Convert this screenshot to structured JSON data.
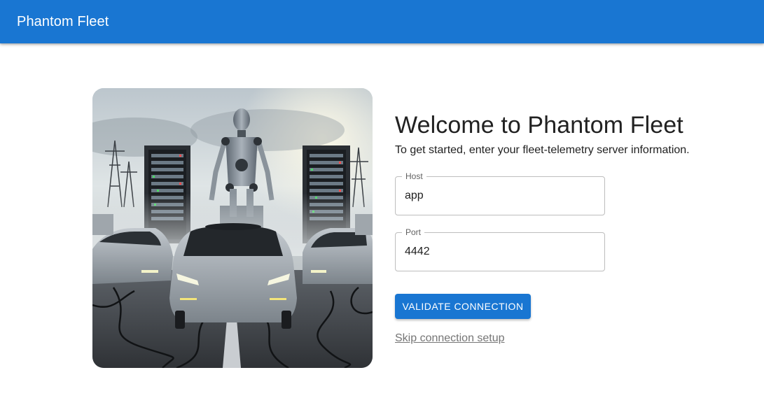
{
  "appbar": {
    "title": "Phantom Fleet",
    "color": "#1976d2"
  },
  "hero": {
    "image_description_icon": "robot-fleet-illustration"
  },
  "welcome": {
    "title": "Welcome to Phantom Fleet",
    "subtitle": "To get started, enter your fleet-telemetry server information."
  },
  "form": {
    "host": {
      "label": "Host",
      "value": "app"
    },
    "port": {
      "label": "Port",
      "value": "4442"
    },
    "validate_label": "VALIDATE CONNECTION",
    "skip_label": "Skip connection setup"
  }
}
